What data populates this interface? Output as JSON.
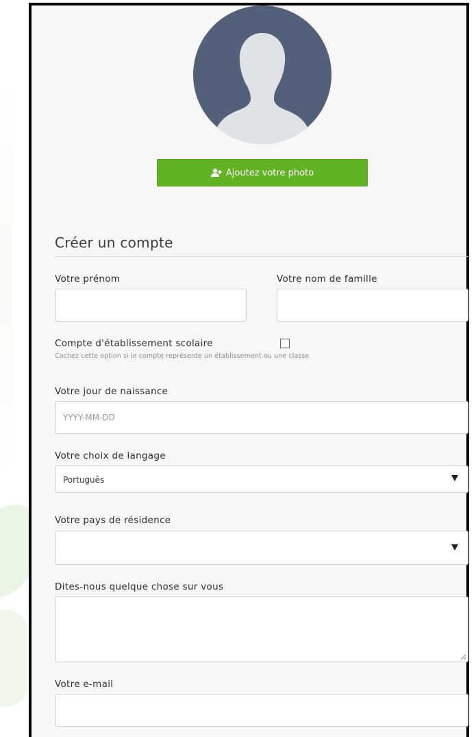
{
  "profile": {
    "add_photo_label": "Ajoutez votre photo"
  },
  "form": {
    "title": "Créer un compte",
    "first_name": {
      "label": "Votre prénom",
      "value": ""
    },
    "last_name": {
      "label": "Votre nom de famille",
      "value": ""
    },
    "school_account": {
      "label": "Compte d'établissement scolaire",
      "checked": false,
      "hint": "Cochez cette option si le compte représente un établissement ou une classe"
    },
    "birthday": {
      "label": "Votre jour de naissance",
      "placeholder": "YYYY-MM-DD",
      "value": ""
    },
    "language": {
      "label": "Votre choix de langage",
      "selected": "Português"
    },
    "country": {
      "label": "Votre pays de résidence",
      "selected": ""
    },
    "about": {
      "label": "Dites-nous quelque chose sur vous",
      "value": ""
    },
    "email": {
      "label": "Votre e-mail",
      "value": ""
    }
  },
  "colors": {
    "accent_green": "#62b225",
    "avatar_bg": "#536079",
    "avatar_silhouette": "#dfe3e6",
    "panel_bg": "#f7f7f7"
  },
  "icons": {
    "add_photo": "add-user-icon",
    "dropdown": "caret-down-icon"
  }
}
